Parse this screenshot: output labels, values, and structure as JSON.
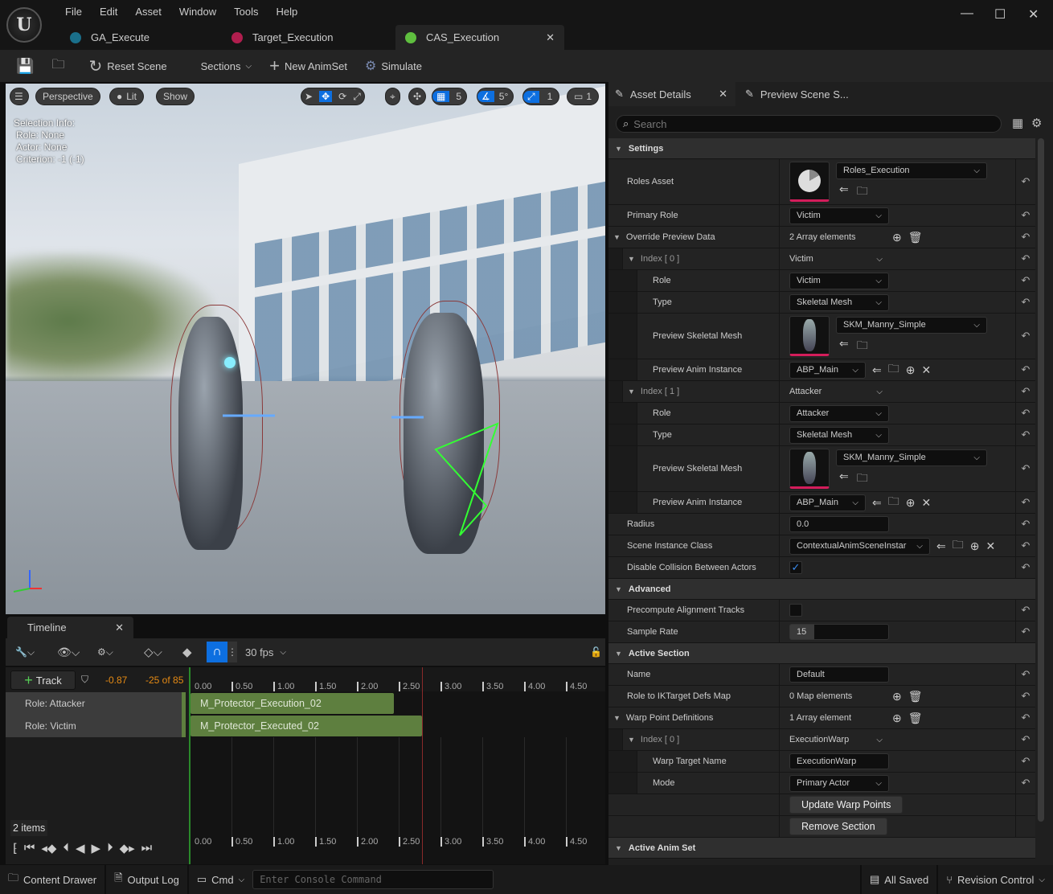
{
  "menu": [
    "File",
    "Edit",
    "Asset",
    "Window",
    "Tools",
    "Help"
  ],
  "tabs": [
    {
      "label": "GA_Execute",
      "color": "#1a8fb0"
    },
    {
      "label": "Target_Execution",
      "color": "#b01e4e"
    },
    {
      "label": "CAS_Execution",
      "color": "#5fbf3f"
    }
  ],
  "toolbar": {
    "reset": "Reset Scene",
    "sections": "Sections",
    "new_animset": "New AnimSet",
    "simulate": "Simulate"
  },
  "viewport": {
    "perspective": "Perspective",
    "lit": "Lit",
    "show": "Show",
    "grid": "5",
    "angle": "5°",
    "scale": "1",
    "camera": "1",
    "selection": [
      "Selection Info:",
      "Role: None",
      "Actor: None",
      "Criterion: -1 (-1)"
    ]
  },
  "timeline": {
    "tab": "Timeline",
    "fps": "30 fps",
    "track_btn": "Track",
    "time": "-0.87",
    "frame": "-25 of 85",
    "items": "2 items",
    "ticks": [
      "0.00",
      "0.50",
      "1.00",
      "1.50",
      "2.00",
      "2.50",
      "3.00",
      "3.50",
      "4.00",
      "4.50"
    ],
    "tracks": [
      "Role: Attacker",
      "Role: Victim"
    ],
    "clips": [
      "M_Protector_Execution_02",
      "M_Protector_Executed_02"
    ]
  },
  "status": {
    "content_drawer": "Content Drawer",
    "output_log": "Output Log",
    "cmd": "Cmd",
    "console_placeholder": "Enter Console Command",
    "saved": "All Saved",
    "revision": "Revision Control"
  },
  "details": {
    "tab1": "Asset Details",
    "tab2": "Preview Scene S...",
    "search": "Search",
    "rows": [
      {
        "kind": "header",
        "label": "Settings"
      },
      {
        "kind": "asset",
        "label": "Roles Asset",
        "value": "Roles_Execution",
        "thumb": "pie",
        "indent": 0
      },
      {
        "kind": "combo",
        "label": "Primary Role",
        "value": "Victim",
        "indent": 0
      },
      {
        "kind": "array",
        "label": "Override Preview Data",
        "value": "2 Array elements",
        "indent": 0,
        "arrow": true
      },
      {
        "kind": "plain",
        "label": "Index [ 0 ]",
        "value": "Victim",
        "indent": 1,
        "arrow": true
      },
      {
        "kind": "combo",
        "label": "Role",
        "value": "Victim",
        "indent": 2
      },
      {
        "kind": "combo",
        "label": "Type",
        "value": "Skeletal Mesh",
        "indent": 2
      },
      {
        "kind": "asset",
        "label": "Preview Skeletal Mesh",
        "value": "SKM_Manny_Simple",
        "thumb": "mesh",
        "indent": 2
      },
      {
        "kind": "class",
        "label": "Preview Anim Instance",
        "value": "ABP_Main",
        "indent": 2
      },
      {
        "kind": "plain",
        "label": "Index [ 1 ]",
        "value": "Attacker",
        "indent": 1,
        "arrow": true
      },
      {
        "kind": "combo",
        "label": "Role",
        "value": "Attacker",
        "indent": 2
      },
      {
        "kind": "combo",
        "label": "Type",
        "value": "Skeletal Mesh",
        "indent": 2
      },
      {
        "kind": "asset",
        "label": "Preview Skeletal Mesh",
        "value": "SKM_Manny_Simple",
        "thumb": "mesh",
        "indent": 2
      },
      {
        "kind": "class",
        "label": "Preview Anim Instance",
        "value": "ABP_Main",
        "indent": 2
      },
      {
        "kind": "text",
        "label": "Radius",
        "value": "0.0",
        "indent": 0
      },
      {
        "kind": "class",
        "label": "Scene Instance Class",
        "value": "ContextualAnimSceneInstar",
        "indent": 0,
        "wide": true
      },
      {
        "kind": "check",
        "label": "Disable Collision Between Actors",
        "value": "✓",
        "indent": 0
      },
      {
        "kind": "header",
        "label": "Advanced"
      },
      {
        "kind": "check",
        "label": "Precompute Alignment Tracks",
        "value": "",
        "indent": 0
      },
      {
        "kind": "text",
        "label": "Sample Rate",
        "value": "15",
        "indent": 0,
        "slider": true
      },
      {
        "kind": "header",
        "label": "Active Section"
      },
      {
        "kind": "text",
        "label": "Name",
        "value": "Default",
        "indent": 0
      },
      {
        "kind": "array",
        "label": "Role to IKTarget Defs Map",
        "value": "0 Map elements",
        "indent": 0
      },
      {
        "kind": "array",
        "label": "Warp Point Definitions",
        "value": "1 Array element",
        "indent": 0,
        "arrow": true
      },
      {
        "kind": "plain",
        "label": "Index [ 0 ]",
        "value": "ExecutionWarp",
        "indent": 1,
        "arrow": true
      },
      {
        "kind": "text",
        "label": "Warp Target Name",
        "value": "ExecutionWarp",
        "indent": 2
      },
      {
        "kind": "combo",
        "label": "Mode",
        "value": "Primary Actor",
        "indent": 2
      },
      {
        "kind": "button",
        "label": "",
        "value": "Update Warp Points"
      },
      {
        "kind": "button",
        "label": "",
        "value": "Remove Section"
      },
      {
        "kind": "header",
        "label": "Active Anim Set"
      }
    ]
  }
}
